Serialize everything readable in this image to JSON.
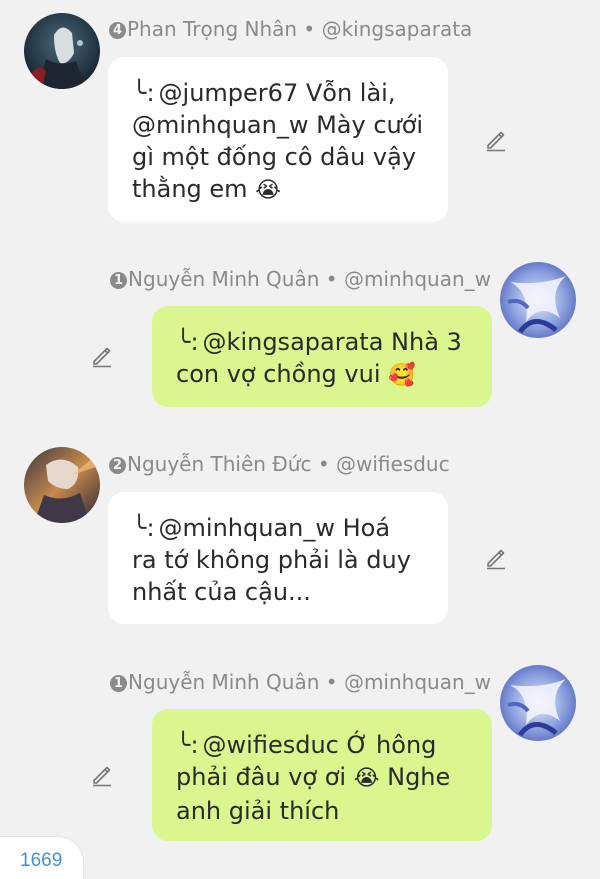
{
  "messages": [
    {
      "rank": "4",
      "name": "Phan Trọng Nhân",
      "separator": "•",
      "handle": "@kingsaparata",
      "reply_mark": "╰:",
      "lines": [
        "@jumper67 Vỗn lài,",
        "@minhquan_w Mày cưới",
        "gì một đống cô dâu vậy",
        "thằng em"
      ],
      "emoji": "😭",
      "avatar_icon": "dark-anime-avatar"
    },
    {
      "rank": "1",
      "name": "Nguyễn Minh Quân",
      "separator": "•",
      "handle": "@minhquan_w",
      "reply_mark": "╰:",
      "lines": [
        "@kingsaparata Nhà 3",
        "con vợ chồng vui"
      ],
      "emoji": "🥰",
      "avatar_icon": "blue-anime-avatar"
    },
    {
      "rank": "2",
      "name": "Nguyễn Thiên Đức",
      "separator": "•",
      "handle": "@wifiesduc",
      "reply_mark": "╰:",
      "lines": [
        "@minhquan_w Hoá",
        "ra tớ không phải là duy",
        "nhất của cậu..."
      ],
      "emoji": "",
      "avatar_icon": "sunset-anime-avatar"
    },
    {
      "rank": "1",
      "name": "Nguyễn Minh Quân",
      "separator": "•",
      "handle": "@minhquan_w",
      "reply_mark": "╰:",
      "lines": [
        "@wifiesduc Ớ hông",
        "phải đâu vợ ơi",
        "anh giải thích"
      ],
      "emoji": "😭",
      "emoji_after": "Nghe",
      "avatar_icon": "blue-anime-avatar"
    }
  ],
  "edit_icon": "pencil-icon",
  "page_counter": "1669",
  "colors": {
    "background": "#f1f1f1",
    "bubble_incoming": "#ffffff",
    "bubble_outgoing": "#d9f68f",
    "header_text": "#8a8a8a",
    "counter_text": "#4d8ec8"
  }
}
